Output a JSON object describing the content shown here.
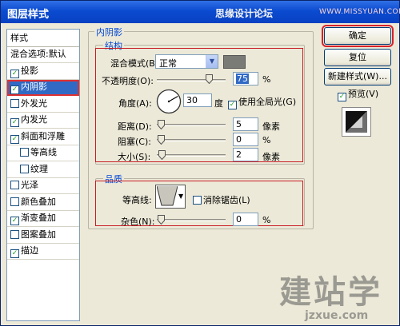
{
  "window": {
    "title": "图层样式"
  },
  "watermark": {
    "site": "思缘设计论坛",
    "url": "WWW.MISSYUAN.COM"
  },
  "sidebar": {
    "header": "样式",
    "items": [
      {
        "label": "混合选项:默认",
        "checkbox": false,
        "checked": false,
        "indent": false,
        "selected": false
      },
      {
        "label": "投影",
        "checkbox": true,
        "checked": true,
        "indent": false,
        "selected": false
      },
      {
        "label": "内阴影",
        "checkbox": true,
        "checked": true,
        "indent": false,
        "selected": true
      },
      {
        "label": "外发光",
        "checkbox": true,
        "checked": false,
        "indent": false,
        "selected": false
      },
      {
        "label": "内发光",
        "checkbox": true,
        "checked": true,
        "indent": false,
        "selected": false
      },
      {
        "label": "斜面和浮雕",
        "checkbox": true,
        "checked": true,
        "indent": false,
        "selected": false
      },
      {
        "label": "等高线",
        "checkbox": true,
        "checked": false,
        "indent": true,
        "selected": false
      },
      {
        "label": "纹理",
        "checkbox": true,
        "checked": false,
        "indent": true,
        "selected": false
      },
      {
        "label": "光泽",
        "checkbox": true,
        "checked": false,
        "indent": false,
        "selected": false
      },
      {
        "label": "颜色叠加",
        "checkbox": true,
        "checked": false,
        "indent": false,
        "selected": false
      },
      {
        "label": "渐变叠加",
        "checkbox": true,
        "checked": true,
        "indent": false,
        "selected": false
      },
      {
        "label": "图案叠加",
        "checkbox": true,
        "checked": false,
        "indent": false,
        "selected": false
      },
      {
        "label": "描边",
        "checkbox": true,
        "checked": true,
        "indent": false,
        "selected": false
      }
    ]
  },
  "panel": {
    "group_title": "内阴影",
    "structure": {
      "title": "结构",
      "blend_mode_label": "混合模式(B):",
      "blend_mode_value": "正常",
      "shadow_color": "#7a7a76",
      "opacity_label": "不透明度(O):",
      "opacity_value": "75",
      "opacity_unit": "%",
      "opacity_level": 0.75,
      "angle_label": "角度(A):",
      "angle_value": "30",
      "angle_unit": "度",
      "global_light_label": "使用全局光(G)",
      "global_light_checked": true,
      "distance_label": "距离(D):",
      "distance_value": "5",
      "distance_unit": "像素",
      "choke_label": "阻塞(C):",
      "choke_value": "0",
      "choke_unit": "%",
      "size_label": "大小(S):",
      "size_value": "2",
      "size_unit": "像素"
    },
    "quality": {
      "title": "品质",
      "contour_label": "等高线:",
      "antialias_label": "消除锯齿(L)",
      "antialias_checked": false,
      "noise_label": "杂色(N):",
      "noise_value": "0",
      "noise_unit": "%"
    }
  },
  "buttons": {
    "ok": "确定",
    "reset": "复位",
    "new_style": "新建样式(W)...",
    "preview": "预览(V)",
    "preview_checked": true
  },
  "logo": {
    "text": "建站学",
    "url": "jzxue.com"
  }
}
